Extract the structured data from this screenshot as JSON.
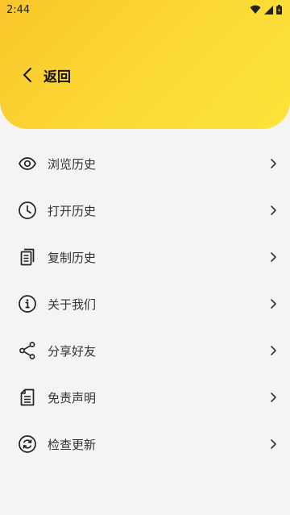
{
  "status_bar": {
    "time": "2:44"
  },
  "header": {
    "back_label": "返回"
  },
  "menu": [
    {
      "key": "browse-history",
      "label": "浏览历史",
      "icon": "eye-icon"
    },
    {
      "key": "open-history",
      "label": "打开历史",
      "icon": "clock-icon"
    },
    {
      "key": "copy-history",
      "label": "复制历史",
      "icon": "document-copy-icon"
    },
    {
      "key": "about-us",
      "label": "关于我们",
      "icon": "info-icon"
    },
    {
      "key": "share-friends",
      "label": "分享好友",
      "icon": "share-icon"
    },
    {
      "key": "disclaimer",
      "label": "免责声明",
      "icon": "document-icon"
    },
    {
      "key": "check-update",
      "label": "检查更新",
      "icon": "refresh-icon"
    }
  ],
  "colors": {
    "header_start": "#fac62b",
    "header_end": "#fde33a",
    "background": "#f4f4f4"
  }
}
